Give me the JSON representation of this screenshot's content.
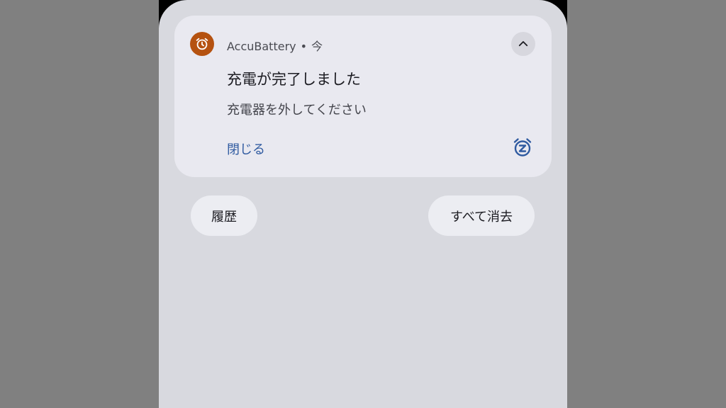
{
  "notification": {
    "app_name": "AccuBattery",
    "separator": "•",
    "time": "今",
    "title": "充電が完了しました",
    "body": "充電器を外してください",
    "action_close": "閉じる",
    "icon": "alarm-clock-icon",
    "icon_color": "#b55210",
    "expand_icon": "chevron-up-icon",
    "snooze_icon": "snooze-alarm-icon",
    "action_color": "#2f5aa0"
  },
  "footer": {
    "history_label": "履歴",
    "clear_all_label": "すべて消去"
  }
}
